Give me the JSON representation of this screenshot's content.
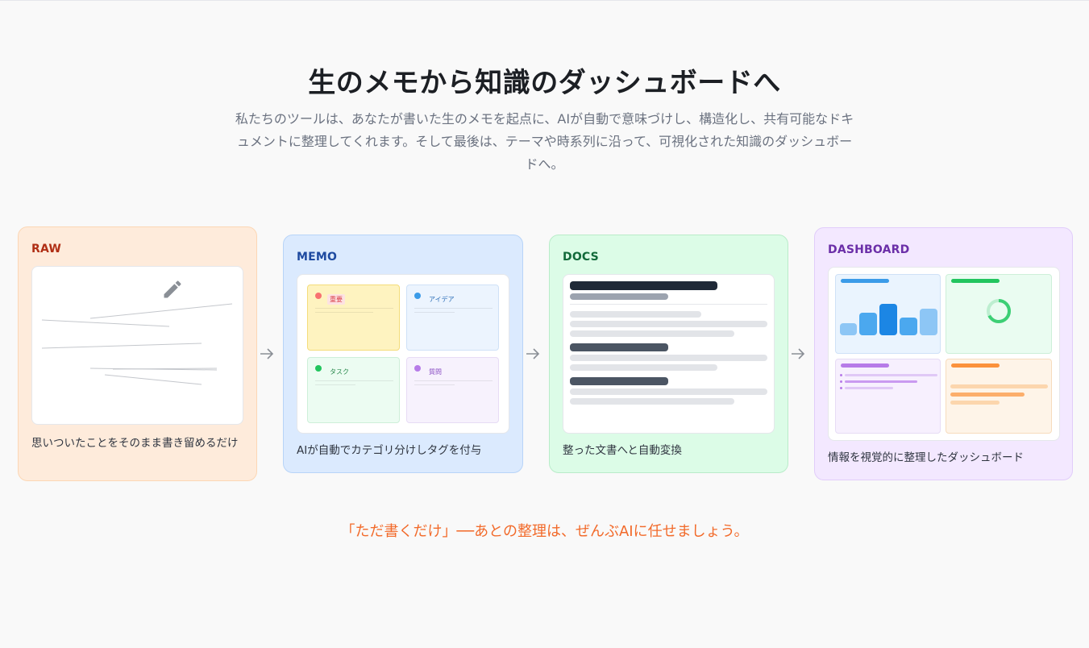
{
  "hero": {
    "title": "生のメモから知識のダッシュボードへ",
    "description": "私たちのツールは、あなたが書いた生のメモを起点に、AIが自動で意味づけし、構造化し、共有可能なドキュメントに整理してくれます。そして最後は、テーマや時系列に沿って、可視化された知識のダッシュボードへ。"
  },
  "cards": {
    "raw": {
      "label": "RAW",
      "caption": "思いついたことをそのまま書き留めるだけ",
      "icon": "pencil-icon"
    },
    "memo": {
      "label": "MEMO",
      "caption": "AIが自動でカテゴリ分けしタグを付与",
      "notes": [
        {
          "tag": "重要",
          "color": "#f87171"
        },
        {
          "tag": "アイデア",
          "color": "#3b9be8"
        },
        {
          "tag": "タスク",
          "color": "#22c55e"
        },
        {
          "tag": "質問",
          "color": "#b77be8"
        }
      ]
    },
    "docs": {
      "label": "DOCS",
      "caption": "整った文書へと自動変換"
    },
    "dashboard": {
      "label": "DASHBOARD",
      "caption": "情報を視覚的に整理したダッシュボード"
    }
  },
  "footer": {
    "tagline": "「ただ書くだけ」──あとの整理は、ぜんぶAIに任せましょう。"
  },
  "colors": {
    "accent": "#f26a2a",
    "raw": "#feebdb",
    "memo": "#dbeafe",
    "docs": "#dcfce7",
    "dashboard": "#f3e8ff"
  }
}
